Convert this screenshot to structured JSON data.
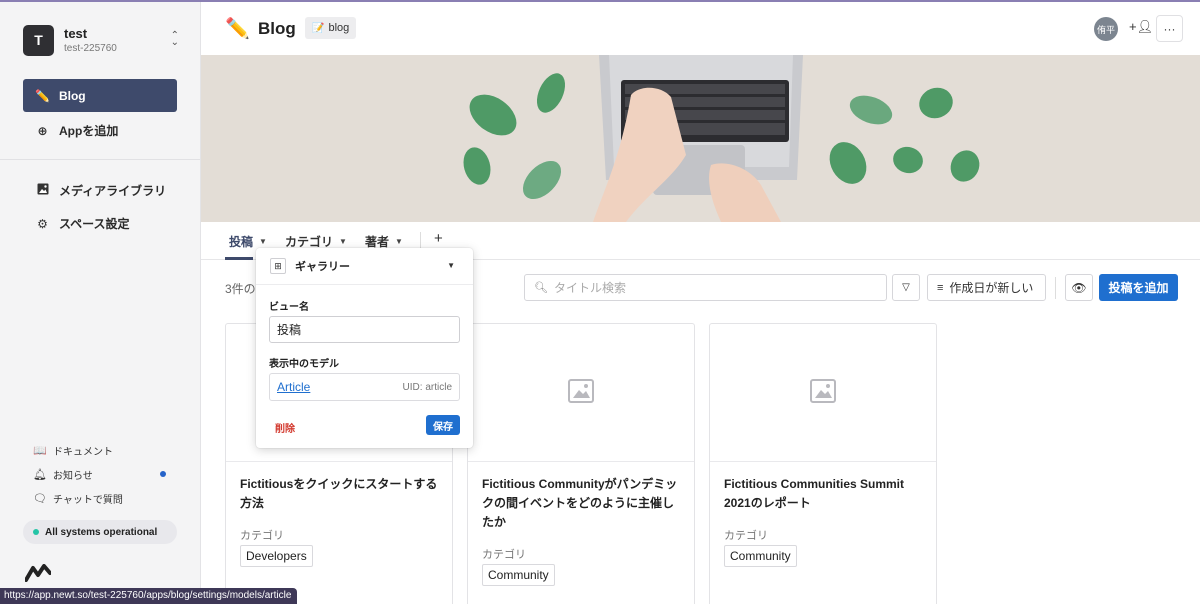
{
  "sidebar": {
    "space": {
      "avatar_letter": "T",
      "name": "test",
      "id": "test-225760"
    },
    "apps": [
      {
        "label": "Blog",
        "icon": "pencil-icon",
        "active": true
      }
    ],
    "add_app_label": "Appを追加",
    "media_library_label": "メディアライブラリ",
    "space_settings_label": "スペース設定",
    "bottom": {
      "docs_label": "ドキュメント",
      "notice_label": "お知らせ",
      "chat_label": "チャットで質問",
      "status_label": "All systems operational"
    },
    "accent_color": "#3e4a6b"
  },
  "header": {
    "title": "Blog",
    "uid_tag": "blog",
    "user_avatar_text": "侑平"
  },
  "tabs": [
    {
      "label": "投稿",
      "active": true
    },
    {
      "label": "カテゴリ",
      "active": false
    },
    {
      "label": "著者",
      "active": false
    }
  ],
  "toolbar": {
    "count_text": "3件の",
    "search_placeholder": "タイトル検索",
    "sort_label": "作成日が新しい",
    "add_button_label": "投稿を追加",
    "primary_color": "#1f6fcf"
  },
  "cards": [
    {
      "title": "Fictitiousをクイックにスタートする方法",
      "category_label": "カテゴリ",
      "category": "Developers"
    },
    {
      "title": "Fictitious Communityがパンデミックの間イベントをどのように主催したか",
      "category_label": "カテゴリ",
      "category": "Community"
    },
    {
      "title": "Fictitious Communities Summit 2021のレポート",
      "category_label": "カテゴリ",
      "category": "Community"
    }
  ],
  "popup": {
    "view_type": "ギャラリー",
    "view_name_label": "ビュー名",
    "view_name_value": "投稿",
    "model_label": "表示中のモデル",
    "model_name": "Article",
    "model_uid": "UID: article",
    "delete_label": "削除",
    "save_label": "保存"
  },
  "status_bar": {
    "url": "https://app.newt.so/test-225760/apps/blog/settings/models/article"
  }
}
